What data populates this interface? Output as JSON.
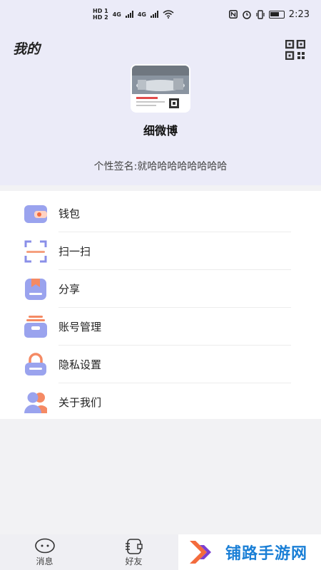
{
  "status_bar": {
    "sim1": "HD 1",
    "sim2": "HD 2",
    "network1": "4G",
    "network2": "4G",
    "time": "2:23"
  },
  "header": {
    "title": "我的",
    "username": "细微博",
    "signature": "个性签名:就哈哈哈哈哈哈哈哈"
  },
  "menu": {
    "items": [
      {
        "label": "钱包",
        "icon": "wallet-icon"
      },
      {
        "label": "扫一扫",
        "icon": "scan-icon"
      },
      {
        "label": "分享",
        "icon": "share-icon"
      },
      {
        "label": "账号管理",
        "icon": "account-manage-icon"
      },
      {
        "label": "隐私设置",
        "icon": "lock-icon"
      },
      {
        "label": "关于我们",
        "icon": "users-icon"
      }
    ]
  },
  "tabbar": {
    "tabs": [
      {
        "label": "消息",
        "icon": "message-icon"
      },
      {
        "label": "好友",
        "icon": "friends-icon"
      }
    ]
  },
  "watermark": {
    "text": "铺路手游网"
  },
  "colors": {
    "header_bg": "#ebebf8",
    "accent_orange": "#f36b3d",
    "accent_purple": "#8a8fe8",
    "watermark_blue": "#1a7fd6"
  }
}
